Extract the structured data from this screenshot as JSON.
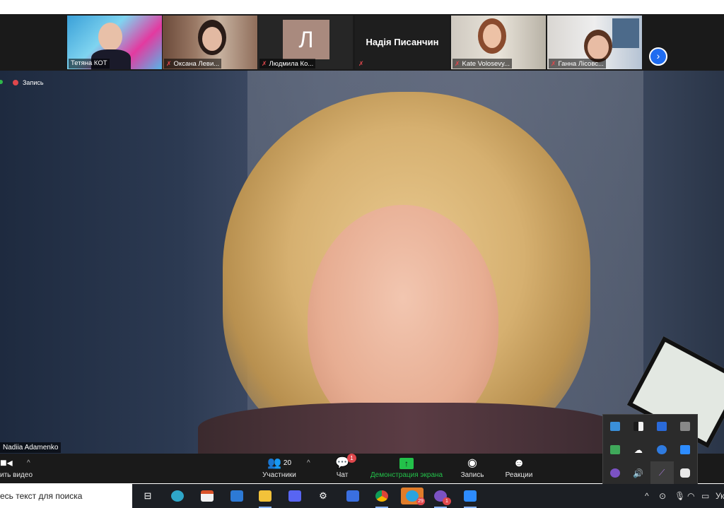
{
  "participants": [
    {
      "name": "Тетяна КОТ",
      "muted": false
    },
    {
      "name": "Оксана Леви...",
      "muted": true
    },
    {
      "name": "Людмила Ко...",
      "muted": true,
      "initial": "Л"
    },
    {
      "name": "Надія Писанчин",
      "muted": true,
      "video_off": true
    },
    {
      "name": "Kate Volosevy...",
      "muted": true
    },
    {
      "name": "Ганна Лісовс...",
      "muted": true
    }
  ],
  "next_icon": "chevron-right-icon",
  "recording": {
    "label": "Запись",
    "color": "#e0474c"
  },
  "speaker": {
    "name": "Nadiia Adamenko"
  },
  "toolbar": {
    "video_label": "ить видео",
    "participants_count": "20",
    "participants_label": "Участники",
    "chat_label": "Чат",
    "chat_badge": "1",
    "share_label": "Демонстрация экрана",
    "record_label": "Запись",
    "reactions_label": "Реакции"
  },
  "colors": {
    "accent_green": "#23c14a",
    "badge_red": "#e0474c",
    "toolbar_bg": "#1a1a1a",
    "zoom_blue": "#1f6cf0"
  },
  "tray_icons": [
    "monitor-icon",
    "security-icon",
    "word-icon",
    "clipboard-icon",
    "display-check-icon",
    "cloud-off-icon",
    "chrome-icon",
    "zoom-icon",
    "viber-icon",
    "speaker-icon",
    "pen-icon",
    "discord-icon"
  ],
  "taskbar": {
    "search_placeholder": "есь текст для поиска",
    "apps": [
      "task-view-icon",
      "edge-icon",
      "store-icon",
      "mail-icon",
      "file-explorer-icon",
      "discord-icon",
      "settings-icon",
      "wps-icon",
      "chrome-icon",
      "telegram-icon",
      "viber-icon",
      "zoom-icon"
    ],
    "telegram_badge": "29",
    "viber_badge": "1",
    "lang": "Ук"
  }
}
